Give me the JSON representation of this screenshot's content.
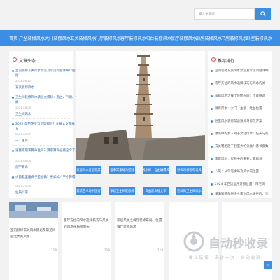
{
  "search": {
    "placeholder": "输入关键词",
    "button_icon": "search-icon"
  },
  "nav": {
    "items": [
      "首页",
      "户型装修风水",
      "大门装修风水",
      "玄关装修风水",
      "门厅装修风水",
      "客厅装修风水",
      "阳台装修风水",
      "餐厅装修风水",
      "厨房装修风水",
      "书房装修风水",
      "卧室装修风水"
    ]
  },
  "left": {
    "title": "文章头条",
    "articles": [
      {
        "title": "室内装修玄关风水禁忌及常见问题详细介绍",
        "line2": "绍",
        "date": "2024-08-12",
        "sub": "玄关装修风水"
      },
      {
        "title": "卫生间装修风水禁忌大揭秘：避凶、气顺、健康",
        "line2": "康",
        "date": "2024-08-09",
        "sub": "卫生间风水"
      },
      {
        "title": "2022 年芭花岁当何等都吗？化解太岁都样",
        "line2": "方",
        "date": "2024-08-07",
        "sub": "十二生肖"
      },
      {
        "title": "道墓克斯字算命准吗？算字算命必要这个了解",
        "line2": "",
        "date": "2024-08-05",
        "sub": "测字算命"
      },
      {
        "title": "点菌乾里雕命于是准确？要如如八字才算得…",
        "line2": "",
        "date": "2024-08-03",
        "sub": "生辰八字"
      }
    ]
  },
  "center": {
    "tags": [
      "家居风水宜忌犯禁",
      "鉴事常家财为招财",
      "风水缘 | 自由编撰风",
      "卧头乐探修有话风",
      "建筑艺术与中国方",
      "家居卫生间装修风",
      "三曲建木楼文军",
      "必知的卫生间风水"
    ]
  },
  "right": {
    "title": "推荐排行",
    "items": [
      "室内装修玄关风水禁忌及常见问题详细",
      "客厅方位的风水选择技巧与风水的关",
      "家居风水之餐厅装修布局：位置挑选",
      "厨房风水：大门、主卧、灶台位置",
      "卧室风水装修禁忌须知与修改方案",
      "建筑中的女人对于文化传承：任天与死",
      "玄关鞋柜放于卧室大的分类？看书反数",
      "家庭风水：屋外中的重要，家居与",
      "八风：从气宅水局及风水的位置",
      "2024 年西历运神方照位置？阳宅风",
      "谨满知道基层企业家对风水途径的，享"
    ]
  },
  "cards": [
    {
      "text": "室内装修玄关风水禁忌及常见问题之类关风水",
      "num": "118"
    },
    {
      "text": "客厅方位的风水选择技巧与风水的风水布局画面布",
      "num": "118"
    },
    {
      "text": "家居风水之餐厅装修布局：位置餐厅装修风水",
      "num": "118"
    },
    {
      "text": "",
      "num": ""
    },
    {
      "text": "",
      "num": ""
    }
  ],
  "watermark": {
    "brand": "自动秒收录",
    "slogan": "做 上 链 接 — 来 访 一 次 — 自 动 收 录"
  },
  "colors": {
    "nav": "#3b8ee4",
    "tag": "#3b8ee4",
    "accent_red": "#e64545",
    "link": "#3366aa"
  }
}
